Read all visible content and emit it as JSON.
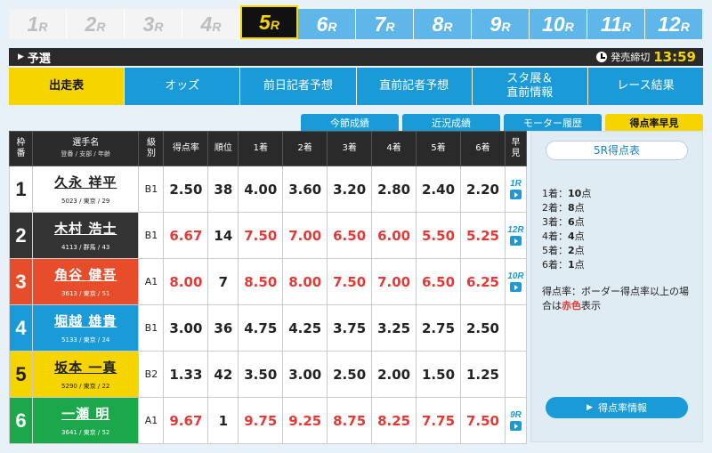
{
  "races": [
    {
      "num": "1",
      "suffix": "R",
      "state": "past"
    },
    {
      "num": "2",
      "suffix": "R",
      "state": "past"
    },
    {
      "num": "3",
      "suffix": "R",
      "state": "past"
    },
    {
      "num": "4",
      "suffix": "R",
      "state": "past"
    },
    {
      "num": "5",
      "suffix": "R",
      "state": "cur"
    },
    {
      "num": "6",
      "suffix": "R",
      "state": "future"
    },
    {
      "num": "7",
      "suffix": "R",
      "state": "future"
    },
    {
      "num": "8",
      "suffix": "R",
      "state": "future"
    },
    {
      "num": "9",
      "suffix": "R",
      "state": "future"
    },
    {
      "num": "10",
      "suffix": "R",
      "state": "future"
    },
    {
      "num": "11",
      "suffix": "R",
      "state": "future"
    },
    {
      "num": "12",
      "suffix": "R",
      "state": "future"
    }
  ],
  "header": {
    "section": "予選",
    "deadline_label": "発売締切",
    "deadline_time": "13:59"
  },
  "menu": [
    "出走表",
    "オッズ",
    "前日記者予想",
    "直前記者予想",
    "スタ展＆\n直前情報",
    "レース結果"
  ],
  "subtabs": [
    "今節成績",
    "近況成績",
    "モーター履歴",
    "得点率早見"
  ],
  "table_headers": {
    "waku": "枠\n番",
    "name": "選手名",
    "name_sub": "登番 / 支部 / 年齢",
    "class": "級\n別",
    "rate": "得点率",
    "rank": "順位",
    "p1": "1着",
    "p2": "2着",
    "p3": "3着",
    "p4": "4着",
    "p5": "5着",
    "p6": "6着",
    "soken": "早\n見"
  },
  "rows": [
    {
      "waku": "1",
      "bg": "#ffffff",
      "fg": "#222222",
      "name": "久永 祥平",
      "meta": "5023 / 東京 / 29",
      "class": "B1",
      "rate": "2.50",
      "rank": "38",
      "p": [
        "4.00",
        "3.60",
        "3.20",
        "2.80",
        "2.40",
        "2.20"
      ],
      "red": false,
      "soken": "1R"
    },
    {
      "waku": "2",
      "bg": "#333333",
      "fg": "#ffffff",
      "name": "木村 浩士",
      "meta": "4113 / 群馬 / 43",
      "class": "B1",
      "rate": "6.67",
      "rank": "14",
      "p": [
        "7.50",
        "7.00",
        "6.50",
        "6.00",
        "5.50",
        "5.25"
      ],
      "red": true,
      "soken": "12R"
    },
    {
      "waku": "3",
      "bg": "#e74c2b",
      "fg": "#ffffff",
      "name": "角谷 健吾",
      "meta": "3613 / 東京 / 51",
      "class": "A1",
      "rate": "8.00",
      "rank": "7",
      "p": [
        "8.50",
        "8.00",
        "7.50",
        "7.00",
        "6.50",
        "6.25"
      ],
      "red": true,
      "soken": "10R"
    },
    {
      "waku": "4",
      "bg": "#1a9ad6",
      "fg": "#ffffff",
      "name": "堀越 雄貴",
      "meta": "5133 / 東京 / 24",
      "class": "B1",
      "rate": "3.00",
      "rank": "36",
      "p": [
        "4.75",
        "4.25",
        "3.75",
        "3.25",
        "2.75",
        "2.50"
      ],
      "red": false,
      "soken": ""
    },
    {
      "waku": "5",
      "bg": "#f5d400",
      "fg": "#222222",
      "name": "坂本 一真",
      "meta": "5290 / 東京 / 22",
      "class": "B2",
      "rate": "1.33",
      "rank": "42",
      "p": [
        "3.50",
        "3.00",
        "2.50",
        "2.00",
        "1.50",
        "1.25"
      ],
      "red": false,
      "soken": ""
    },
    {
      "waku": "6",
      "bg": "#1aa84a",
      "fg": "#ffffff",
      "name": "一瀬 明",
      "meta": "3641 / 東京 / 52",
      "class": "A1",
      "rate": "9.67",
      "rank": "1",
      "p": [
        "9.75",
        "9.25",
        "8.75",
        "8.25",
        "7.75",
        "7.50"
      ],
      "red": true,
      "soken": "9R"
    }
  ],
  "side": {
    "title": "5R得点表",
    "points": [
      {
        "label": "1着：",
        "value": "10",
        "unit": "点"
      },
      {
        "label": "2着：",
        "value": "8",
        "unit": "点"
      },
      {
        "label": "3着：",
        "value": "6",
        "unit": "点"
      },
      {
        "label": "4着：",
        "value": "4",
        "unit": "点"
      },
      {
        "label": "5着：",
        "value": "2",
        "unit": "点"
      },
      {
        "label": "6着：",
        "value": "1",
        "unit": "点"
      }
    ],
    "note_pre": "得点率：ボーダー得点率以上の場合は",
    "note_red": "赤色",
    "note_post": "表示",
    "button": "得点率情報"
  }
}
